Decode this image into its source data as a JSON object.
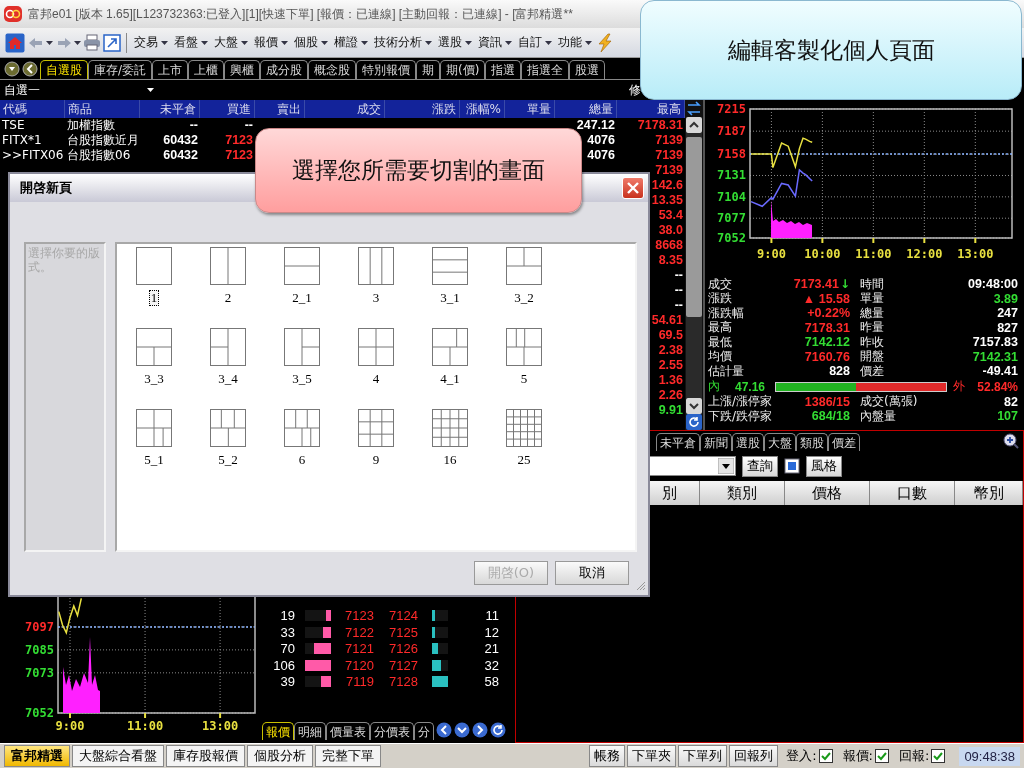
{
  "window": {
    "title": "富邦e01 [版本 1.65][L123732363:已登入][1][快速下單] [報價：已連線] [主動回報：已連線] - [富邦精選**"
  },
  "menus": [
    {
      "label": "交易"
    },
    {
      "label": "看盤"
    },
    {
      "label": "大盤"
    },
    {
      "label": "報價"
    },
    {
      "label": "個股"
    },
    {
      "label": "權證"
    },
    {
      "label": "技術分析"
    },
    {
      "label": "選股"
    },
    {
      "label": "資訊"
    },
    {
      "label": "自訂"
    },
    {
      "label": "功能"
    }
  ],
  "quote_tabs": [
    {
      "label": "自選股",
      "selected": true
    },
    {
      "label": "庫存/委託",
      "selected": false
    },
    {
      "label": "上市",
      "selected": false
    },
    {
      "label": "上櫃",
      "selected": false
    },
    {
      "label": "興櫃",
      "selected": false
    },
    {
      "label": "成分股",
      "selected": false
    },
    {
      "label": "概念股",
      "selected": false
    },
    {
      "label": "特別報價",
      "selected": false
    },
    {
      "label": "期",
      "selected": false
    },
    {
      "label": "期(價)",
      "selected": false
    },
    {
      "label": "指選",
      "selected": false
    },
    {
      "label": "指選全",
      "selected": false
    },
    {
      "label": "股選",
      "selected": false
    }
  ],
  "watchlist": {
    "value": "自選一",
    "edit_label": "修"
  },
  "quote_table": {
    "columns": [
      "代碼",
      "商品",
      "未平倉",
      "買進",
      "賣出",
      "成交",
      "漲跌",
      "漲幅%",
      "單量",
      "總量",
      "最高"
    ],
    "rows": [
      {
        "code": "TSE",
        "name": "加權指數",
        "open_interest": "--",
        "bid": {
          "text": "--",
          "color": "#ffffff"
        },
        "total": "247.12",
        "high": {
          "text": "7178.31",
          "color": "#ff2a2a"
        }
      },
      {
        "code": "FITX*1",
        "name": "台股指數近月",
        "open_interest": "60432",
        "bid": {
          "text": "7123",
          "color": "#ff2a2a"
        },
        "total": "4076",
        "high": {
          "text": "7139",
          "color": "#ff2a2a"
        }
      },
      {
        "code": ">>FITX06",
        "name": "台股指數06",
        "open_interest": "60432",
        "bid": {
          "text": "7123",
          "color": "#ff2a2a"
        },
        "total": "4076",
        "high": {
          "text": "7139",
          "color": "#ff2a2a"
        }
      },
      {
        "high": {
          "text": "7139",
          "color": "#ff2a2a"
        }
      },
      {
        "high": {
          "text": "142.6",
          "color": "#ff2a2a"
        }
      },
      {
        "high": {
          "text": "13.35",
          "color": "#ff2a2a"
        }
      },
      {
        "high": {
          "text": "53.4",
          "color": "#ff2a2a"
        }
      },
      {
        "high": {
          "text": "38.0",
          "color": "#ff2a2a"
        }
      },
      {
        "high": {
          "text": "8668",
          "color": "#ff2a2a"
        }
      },
      {
        "high": {
          "text": "8.35",
          "color": "#ff2a2a"
        }
      },
      {
        "high": {
          "text": "--",
          "color": "#ffffff"
        }
      },
      {
        "high": {
          "text": "--",
          "color": "#ffffff"
        }
      },
      {
        "high": {
          "text": "--",
          "color": "#ffffff"
        }
      },
      {
        "high": {
          "text": "54.61",
          "color": "#ff2a2a"
        }
      },
      {
        "high": {
          "text": "69.5",
          "color": "#ff2a2a"
        }
      },
      {
        "high": {
          "text": "2.38",
          "color": "#ff2a2a"
        }
      },
      {
        "high": {
          "text": "2.55",
          "color": "#ff2a2a"
        }
      },
      {
        "high": {
          "text": "1.36",
          "color": "#ff2a2a"
        }
      },
      {
        "high": {
          "text": "2.26",
          "color": "#ff2a2a"
        }
      },
      {
        "high": {
          "text": "9.91",
          "color": "#33dd33"
        }
      }
    ]
  },
  "index_panel": {
    "chart_data": {
      "type": "line",
      "x": [
        8.6,
        8.82,
        9.0,
        9.03,
        9.2,
        9.33,
        9.47,
        9.55,
        9.62,
        9.67,
        9.75,
        9.8
      ],
      "series": [
        {
          "color": "#e8e040",
          "values": [
            7158,
            7158,
            7158,
            7141,
            7172,
            7168,
            7142,
            7165,
            7178,
            7177,
            7174,
            7173
          ]
        },
        {
          "color": "#6a6aff",
          "values": [
            7098,
            7092,
            7103,
            7101,
            7121,
            7119,
            7105,
            7138,
            7134,
            7132,
            7127,
            7124
          ]
        }
      ],
      "xlim": [
        8.58,
        13.72
      ],
      "ylim": [
        7052,
        7215
      ],
      "xticks": [
        {
          "value": 9,
          "label": "9:00"
        },
        {
          "value": 10,
          "label": "10:00"
        },
        {
          "value": 11,
          "label": "11:00"
        },
        {
          "value": 12,
          "label": "12:00"
        },
        {
          "value": 13,
          "label": "13:00"
        }
      ],
      "yticks": [
        7052,
        7077,
        7104,
        7131,
        7158,
        7187,
        7215
      ],
      "grid": true,
      "ref_lines": [
        {
          "axis": "y",
          "value": 7158
        }
      ]
    },
    "stats": [
      {
        "left": {
          "label": "成交",
          "value": "7173.41",
          "color": "#ff2a2a",
          "arrow": {
            "text": "↓",
            "color": "#33dd33"
          }
        },
        "right": {
          "label": "時間",
          "value": "09:48:00",
          "color": "#ffffff"
        }
      },
      {
        "left": {
          "label": "漲跌",
          "value": "▲ 15.58",
          "color": "#ff2a2a"
        },
        "right": {
          "label": "單量",
          "value": "3.89",
          "color": "#33dd33"
        }
      },
      {
        "left": {
          "label": "漲跌幅",
          "value": "+0.22%",
          "color": "#ff2a2a"
        },
        "right": {
          "label": "總量",
          "value": "247",
          "color": "#ffffff"
        }
      },
      {
        "left": {
          "label": "最高",
          "value": "7178.31",
          "color": "#ff2a2a"
        },
        "right": {
          "label": "昨量",
          "value": "827",
          "color": "#ffffff"
        }
      },
      {
        "left": {
          "label": "最低",
          "value": "7142.12",
          "color": "#33dd33"
        },
        "right": {
          "label": "昨收",
          "value": "7157.83",
          "color": "#ffffff"
        }
      },
      {
        "left": {
          "label": "均價",
          "value": "7160.76",
          "color": "#ff2a2a"
        },
        "right": {
          "label": "開盤",
          "value": "7142.31",
          "color": "#33dd33"
        }
      },
      {
        "left": {
          "label": "估計量",
          "value": "828",
          "color": "#ffffff"
        },
        "right": {
          "label": "價差",
          "value": "-49.41",
          "color": "#ffffff"
        }
      }
    ],
    "flow": {
      "inner_label": "內",
      "inner_value": "47.16",
      "level": 0.4716,
      "outer_label": "外",
      "outer_value": "52.84%"
    },
    "breadth": [
      {
        "left": {
          "label": "上漲/漲停家",
          "value": "1386/15",
          "color": "#ff2a2a"
        },
        "right": {
          "label": "成交(萬張)",
          "value": "82",
          "color": "#ffffff"
        }
      },
      {
        "left": {
          "label": "下跌/跌停家",
          "value": "684/18",
          "color": "#33dd33"
        },
        "right": {
          "label": "內盤量",
          "value": "107",
          "color": "#33dd33"
        }
      }
    ]
  },
  "tick_chart": {
    "chart_data": {
      "type": "line",
      "x": [
        8.7,
        8.8,
        8.9,
        9.0,
        9.1,
        9.2,
        9.3
      ],
      "series": [
        {
          "color": "#e8e040",
          "values": [
            7105,
            7098,
            7094,
            7102,
            7108,
            7103,
            7112
          ]
        }
      ],
      "xlim": [
        8.68,
        13.93
      ],
      "ylim": [
        7052,
        7113.7
      ],
      "xticks": [
        {
          "value": 9,
          "label": "9:00"
        },
        {
          "value": 11,
          "label": "11:00"
        },
        {
          "value": 13,
          "label": "13:00"
        }
      ],
      "yticks": [
        7052,
        7073,
        7085,
        7097
      ],
      "grid": true,
      "ref_lines": [
        {
          "axis": "y",
          "value": 7097
        }
      ]
    }
  },
  "order_book": {
    "rows": [
      {
        "bid": {
          "volume": "19",
          "price": "7123",
          "level": 0.18
        },
        "ask": {
          "price": "7124",
          "volume": "11",
          "level": 0.19
        }
      },
      {
        "bid": {
          "volume": "33",
          "price": "7122",
          "level": 0.31
        },
        "ask": {
          "price": "7125",
          "volume": "12",
          "level": 0.21
        }
      },
      {
        "bid": {
          "volume": "70",
          "price": "7121",
          "level": 0.66
        },
        "ask": {
          "price": "7126",
          "volume": "21",
          "level": 0.36
        }
      },
      {
        "bid": {
          "volume": "106",
          "price": "7120",
          "level": 1.0
        },
        "ask": {
          "price": "7127",
          "volume": "32",
          "level": 0.55
        }
      },
      {
        "bid": {
          "volume": "39",
          "price": "7119",
          "level": 0.37
        },
        "ask": {
          "price": "7128",
          "volume": "58",
          "level": 1.0
        }
      }
    ],
    "tabs": [
      {
        "label": "報價",
        "selected": true
      },
      {
        "label": "明細",
        "selected": false
      },
      {
        "label": "價量表",
        "selected": false
      },
      {
        "label": "分價表",
        "selected": false
      },
      {
        "label": "分",
        "selected": false
      }
    ]
  },
  "orders_panel": {
    "tabs": [
      {
        "label": "未平倉",
        "selected": false
      },
      {
        "label": "新聞",
        "selected": false
      },
      {
        "label": "選股",
        "selected": false
      },
      {
        "label": "大盤",
        "selected": false
      },
      {
        "label": "類股",
        "selected": false
      },
      {
        "label": "價差",
        "selected": false
      }
    ],
    "query_button": "查詢",
    "style_button": "風格",
    "columns": [
      "別",
      "類別",
      "價格",
      "口數",
      "幣別"
    ]
  },
  "status_bar": {
    "tabs": [
      {
        "label": "富邦精選",
        "selected": true
      },
      {
        "label": "大盤綜合看盤",
        "selected": false
      },
      {
        "label": "庫存股報價",
        "selected": false
      },
      {
        "label": "個股分析",
        "selected": false
      },
      {
        "label": "完整下單",
        "selected": false
      }
    ],
    "buttons": [
      "帳務",
      "下單夾",
      "下單列",
      "回報列"
    ],
    "indicators": [
      {
        "label": "登入:",
        "checked": true
      },
      {
        "label": "報價:",
        "checked": true
      },
      {
        "label": "回報:",
        "checked": true
      }
    ],
    "clock": "09:48:38"
  },
  "dialog": {
    "title": "開啓新頁",
    "hint": "選擇你要的版式。",
    "layouts": [
      {
        "label": "1",
        "kind": "single",
        "selected": true
      },
      {
        "label": "2",
        "kind": "cols2",
        "selected": false
      },
      {
        "label": "2_1",
        "kind": "rows2",
        "selected": false
      },
      {
        "label": "3",
        "kind": "cols3",
        "selected": false
      },
      {
        "label": "3_1",
        "kind": "rows3",
        "selected": false
      },
      {
        "label": "3_2",
        "kind": "topsplit",
        "selected": false
      },
      {
        "label": "3_3",
        "kind": "bottomsplit",
        "selected": false
      },
      {
        "label": "3_4",
        "kind": "leftsplit",
        "selected": false
      },
      {
        "label": "3_5",
        "kind": "rightsplit",
        "selected": false
      },
      {
        "label": "4",
        "kind": "quad",
        "selected": false
      },
      {
        "label": "4_1",
        "kind": "quadoffset",
        "selected": false
      },
      {
        "label": "5",
        "kind": "fivenarrow",
        "selected": false
      },
      {
        "label": "5_1",
        "kind": "fivebottom",
        "selected": false
      },
      {
        "label": "5_2",
        "kind": "fivetop",
        "selected": false
      },
      {
        "label": "6",
        "kind": "six",
        "selected": false
      },
      {
        "label": "9",
        "kind": "grid3",
        "selected": false
      },
      {
        "label": "16",
        "kind": "grid4",
        "selected": false
      },
      {
        "label": "25",
        "kind": "grid5",
        "selected": false
      }
    ],
    "buttons": [
      {
        "label": "開啓(O)",
        "disabled": true
      },
      {
        "label": "取消",
        "disabled": false
      }
    ]
  },
  "callouts": [
    {
      "text": "編輯客製化個人頁面",
      "kind": "info"
    },
    {
      "text": "選擇您所需要切割的畫面",
      "kind": "alert"
    }
  ]
}
